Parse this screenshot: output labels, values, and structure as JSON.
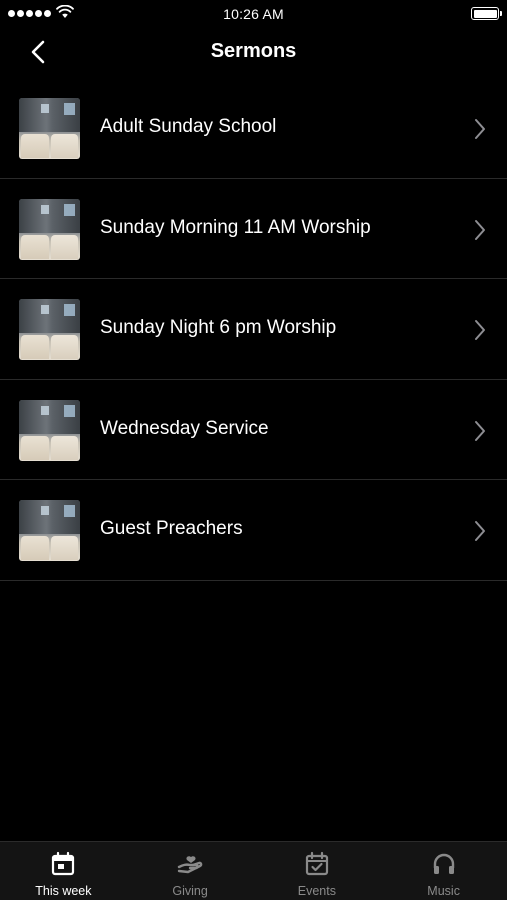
{
  "status_bar": {
    "time": "10:26 AM",
    "signal_icon": "signal-dots-icon",
    "wifi_icon": "wifi-icon",
    "battery_icon": "battery-icon"
  },
  "nav": {
    "title": "Sermons",
    "back_icon": "chevron-left-icon"
  },
  "sermons": [
    {
      "label": "Adult Sunday School",
      "thumbnail": "church-interior-thumbnail"
    },
    {
      "label": "Sunday Morning 11 AM Worship",
      "thumbnail": "church-interior-thumbnail"
    },
    {
      "label": "Sunday Night 6 pm Worship",
      "thumbnail": "church-interior-thumbnail"
    },
    {
      "label": "Wednesday Service",
      "thumbnail": "church-interior-thumbnail"
    },
    {
      "label": "Guest Preachers",
      "thumbnail": "church-interior-thumbnail"
    }
  ],
  "tab_bar": {
    "tabs": [
      {
        "label": "This week",
        "icon": "calendar-day-icon",
        "active": true
      },
      {
        "label": "Giving",
        "icon": "giving-hand-icon",
        "active": false
      },
      {
        "label": "Events",
        "icon": "calendar-check-icon",
        "active": false
      },
      {
        "label": "Music",
        "icon": "headphones-icon",
        "active": false
      }
    ]
  },
  "colors": {
    "background": "#000000",
    "text": "#ffffff",
    "divider": "#2a2a2a",
    "tab_bar_bg": "#141414",
    "inactive_tab": "#8a8a8a"
  }
}
